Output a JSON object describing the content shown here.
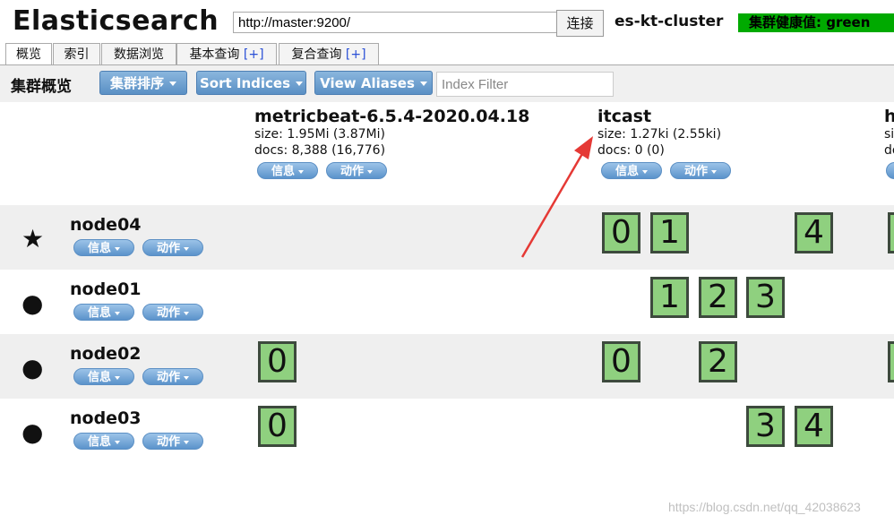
{
  "header": {
    "app_title": "Elasticsearch",
    "url": "http://master:9200/",
    "connect_label": "连接",
    "cluster_name": "es-kt-cluster",
    "health_label": "集群健康值: green"
  },
  "tabs": [
    {
      "label": "概览",
      "plus": ""
    },
    {
      "label": "索引",
      "plus": ""
    },
    {
      "label": "数据浏览",
      "plus": ""
    },
    {
      "label": "基本查询 ",
      "plus": "[+]"
    },
    {
      "label": "复合查询 ",
      "plus": "[+]"
    }
  ],
  "toolbar": {
    "title": "集群概览",
    "sort_cluster_label": "集群排序",
    "sort_indices_label": "Sort Indices",
    "view_aliases_label": "View Aliases",
    "index_filter_placeholder": "Index Filter"
  },
  "indices": [
    {
      "name": "metricbeat-6.5.4-2020.04.18",
      "size": "size: 1.95Mi (3.87Mi)",
      "docs": "docs: 8,388 (16,776)",
      "info_label": "信息",
      "action_label": "动作"
    },
    {
      "name": "itcast",
      "size": "size: 1.27ki (2.55ki)",
      "docs": "docs: 0 (0)",
      "info_label": "信息",
      "action_label": "动作"
    },
    {
      "name": "h",
      "size": "si",
      "docs": "do"
    }
  ],
  "nodes": [
    {
      "name": "node04",
      "icon": "star-icon",
      "info_label": "信息",
      "action_label": "动作"
    },
    {
      "name": "node01",
      "icon": "circle-icon",
      "info_label": "信息",
      "action_label": "动作"
    },
    {
      "name": "node02",
      "icon": "circle-icon",
      "info_label": "信息",
      "action_label": "动作"
    },
    {
      "name": "node03",
      "icon": "circle-icon",
      "info_label": "信息",
      "action_label": "动作"
    }
  ],
  "shards": {
    "node04": [
      "0",
      "1",
      "4"
    ],
    "node01": [
      "1",
      "2",
      "3"
    ],
    "node02": [
      "0",
      "0",
      "2"
    ],
    "node03": [
      "0",
      "3",
      "4"
    ]
  },
  "colors": {
    "health": "#00aa00",
    "shard_fill": "#8fd07f",
    "button_blue": "#5a90c5",
    "annotation_arrow": "#e53935"
  },
  "watermark": "https://blog.csdn.net/qq_42038623"
}
